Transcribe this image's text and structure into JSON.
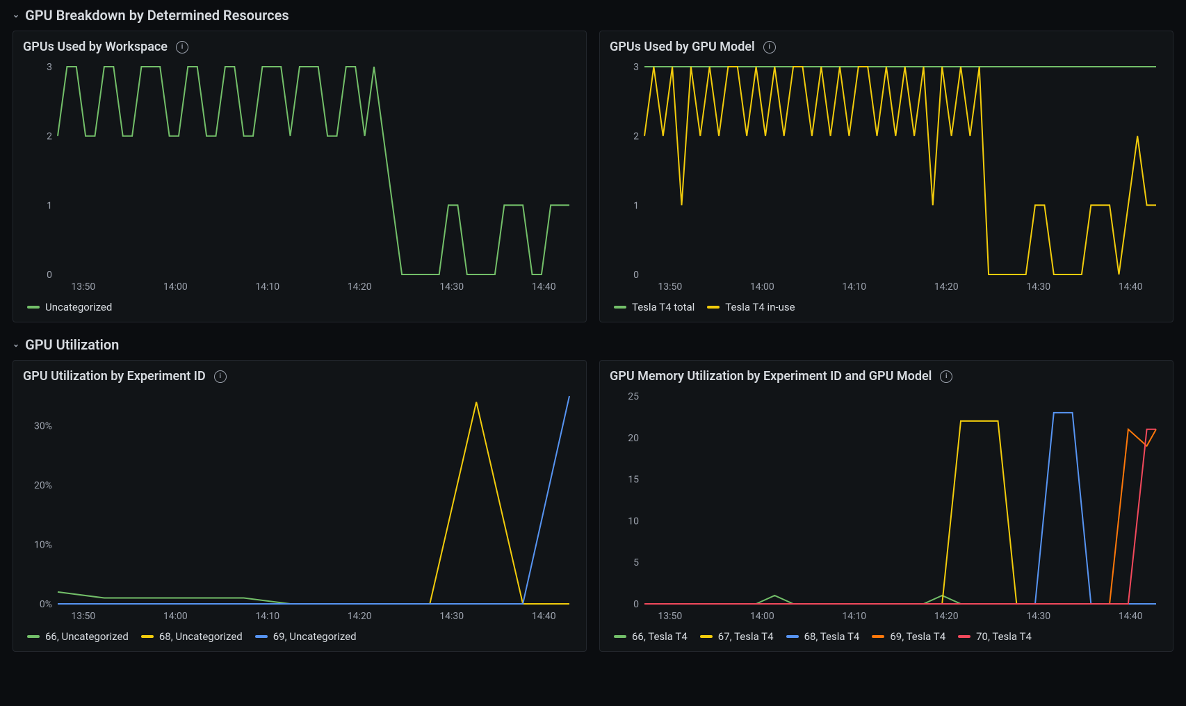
{
  "sections": [
    {
      "id": "breakdown",
      "title": "GPU Breakdown by Determined Resources"
    },
    {
      "id": "util",
      "title": "GPU Utilization"
    }
  ],
  "panels": {
    "workspace": {
      "title": "GPUs Used by Workspace"
    },
    "gpumodel": {
      "title": "GPUs Used by GPU Model"
    },
    "exp_util": {
      "title": "GPU Utilization by Experiment ID"
    },
    "mem_util": {
      "title": "GPU Memory Utilization by Experiment ID and GPU Model"
    }
  },
  "chart_data": [
    {
      "id": "workspace",
      "type": "line",
      "xlabel": "",
      "ylabel": "",
      "ylim": [
        0,
        3
      ],
      "y_ticks": [
        0,
        1,
        2,
        3
      ],
      "x_tick_labels": [
        "13:50",
        "14:00",
        "14:10",
        "14:20",
        "14:30",
        "14:40"
      ],
      "x": [
        0,
        1,
        2,
        3,
        4,
        5,
        6,
        7,
        8,
        9,
        10,
        11,
        12,
        13,
        14,
        15,
        16,
        17,
        18,
        19,
        20,
        21,
        22,
        23,
        24,
        25,
        26,
        27,
        28,
        29,
        30,
        31,
        32,
        33,
        34,
        35,
        36,
        37,
        38,
        39,
        40,
        41,
        42,
        43,
        44,
        45,
        46,
        47,
        48,
        49,
        50,
        51,
        52,
        53,
        54,
        55
      ],
      "series": [
        {
          "name": "Uncategorized",
          "color": "var(--green)",
          "values": [
            2,
            3,
            3,
            2,
            2,
            3,
            3,
            2,
            2,
            3,
            3,
            3,
            2,
            2,
            3,
            3,
            2,
            2,
            3,
            3,
            2,
            2,
            3,
            3,
            3,
            2,
            3,
            3,
            3,
            2,
            2,
            3,
            3,
            2,
            3,
            2,
            1,
            0,
            0,
            0,
            0,
            0,
            1,
            1,
            0,
            0,
            0,
            0,
            1,
            1,
            1,
            0,
            0,
            1,
            1,
            1
          ]
        }
      ]
    },
    {
      "id": "gpumodel",
      "type": "line",
      "xlabel": "",
      "ylabel": "",
      "ylim": [
        0,
        3
      ],
      "y_ticks": [
        0,
        1,
        2,
        3
      ],
      "x_tick_labels": [
        "13:50",
        "14:00",
        "14:10",
        "14:20",
        "14:30",
        "14:40"
      ],
      "x": [
        0,
        1,
        2,
        3,
        4,
        5,
        6,
        7,
        8,
        9,
        10,
        11,
        12,
        13,
        14,
        15,
        16,
        17,
        18,
        19,
        20,
        21,
        22,
        23,
        24,
        25,
        26,
        27,
        28,
        29,
        30,
        31,
        32,
        33,
        34,
        35,
        36,
        37,
        38,
        39,
        40,
        41,
        42,
        43,
        44,
        45,
        46,
        47,
        48,
        49,
        50,
        51,
        52,
        53,
        54,
        55
      ],
      "series": [
        {
          "name": "Tesla T4 total",
          "color": "var(--green)",
          "values": [
            3,
            3,
            3,
            3,
            3,
            3,
            3,
            3,
            3,
            3,
            3,
            3,
            3,
            3,
            3,
            3,
            3,
            3,
            3,
            3,
            3,
            3,
            3,
            3,
            3,
            3,
            3,
            3,
            3,
            3,
            3,
            3,
            3,
            3,
            3,
            3,
            3,
            3,
            3,
            3,
            3,
            3,
            3,
            3,
            3,
            3,
            3,
            3,
            3,
            3,
            3,
            3,
            3,
            3,
            3,
            3
          ]
        },
        {
          "name": "Tesla T4 in-use",
          "color": "var(--yellow)",
          "values": [
            2,
            3,
            2,
            3,
            1,
            3,
            2,
            3,
            2,
            3,
            3,
            2,
            3,
            2,
            3,
            2,
            3,
            3,
            2,
            3,
            2,
            3,
            2,
            3,
            3,
            2,
            3,
            2,
            3,
            2,
            3,
            1,
            3,
            2,
            3,
            2,
            3,
            0,
            0,
            0,
            0,
            0,
            1,
            1,
            0,
            0,
            0,
            0,
            1,
            1,
            1,
            0,
            1,
            2,
            1,
            1
          ]
        }
      ]
    },
    {
      "id": "exp_util",
      "type": "line",
      "xlabel": "",
      "ylabel": "",
      "ylim": [
        0,
        35
      ],
      "y_ticks": [
        0,
        10,
        20,
        30
      ],
      "y_tick_suffix": "%",
      "x_tick_labels": [
        "13:50",
        "14:00",
        "14:10",
        "14:20",
        "14:30",
        "14:40"
      ],
      "x": [
        0,
        5,
        10,
        15,
        20,
        25,
        30,
        35,
        40,
        45,
        50,
        55
      ],
      "series": [
        {
          "name": "66, Uncategorized",
          "color": "var(--green)",
          "values": [
            2,
            1,
            1,
            1,
            1,
            0,
            0,
            0,
            0,
            0,
            0,
            0
          ]
        },
        {
          "name": "68, Uncategorized",
          "color": "var(--yellow)",
          "values": [
            0,
            0,
            0,
            0,
            0,
            0,
            0,
            0,
            0,
            34,
            0,
            0
          ]
        },
        {
          "name": "69, Uncategorized",
          "color": "var(--blue)",
          "values": [
            0,
            0,
            0,
            0,
            0,
            0,
            0,
            0,
            0,
            0,
            0,
            35
          ]
        }
      ]
    },
    {
      "id": "mem_util",
      "type": "line",
      "xlabel": "",
      "ylabel": "",
      "ylim": [
        0,
        25
      ],
      "y_ticks": [
        0,
        5,
        10,
        15,
        20,
        25
      ],
      "x_tick_labels": [
        "13:50",
        "14:00",
        "14:10",
        "14:20",
        "14:30",
        "14:40"
      ],
      "x": [
        0,
        2,
        4,
        6,
        8,
        10,
        12,
        14,
        16,
        18,
        20,
        22,
        24,
        26,
        28,
        30,
        32,
        34,
        36,
        38,
        40,
        42,
        44,
        46,
        48,
        50,
        52,
        54,
        55
      ],
      "series": [
        {
          "name": "66, Tesla T4",
          "color": "var(--green)",
          "values": [
            0,
            0,
            0,
            0,
            0,
            0,
            0,
            1,
            0,
            0,
            0,
            0,
            0,
            0,
            0,
            0,
            1,
            0,
            0,
            0,
            0,
            0,
            0,
            0,
            0,
            0,
            0,
            0,
            0
          ]
        },
        {
          "name": "67, Tesla T4",
          "color": "var(--yellow)",
          "values": [
            0,
            0,
            0,
            0,
            0,
            0,
            0,
            0,
            0,
            0,
            0,
            0,
            0,
            0,
            0,
            0,
            0,
            22,
            22,
            22,
            0,
            0,
            0,
            0,
            0,
            0,
            0,
            0,
            0
          ]
        },
        {
          "name": "68, Tesla T4",
          "color": "var(--blue)",
          "values": [
            0,
            0,
            0,
            0,
            0,
            0,
            0,
            0,
            0,
            0,
            0,
            0,
            0,
            0,
            0,
            0,
            0,
            0,
            0,
            0,
            0,
            0,
            23,
            23,
            0,
            0,
            0,
            0,
            0
          ]
        },
        {
          "name": "69, Tesla T4",
          "color": "var(--orange)",
          "values": [
            0,
            0,
            0,
            0,
            0,
            0,
            0,
            0,
            0,
            0,
            0,
            0,
            0,
            0,
            0,
            0,
            0,
            0,
            0,
            0,
            0,
            0,
            0,
            0,
            0,
            0,
            21,
            19,
            21
          ]
        },
        {
          "name": "70, Tesla T4",
          "color": "var(--red)",
          "values": [
            0,
            0,
            0,
            0,
            0,
            0,
            0,
            0,
            0,
            0,
            0,
            0,
            0,
            0,
            0,
            0,
            0,
            0,
            0,
            0,
            0,
            0,
            0,
            0,
            0,
            0,
            0,
            21,
            21
          ]
        }
      ]
    }
  ]
}
